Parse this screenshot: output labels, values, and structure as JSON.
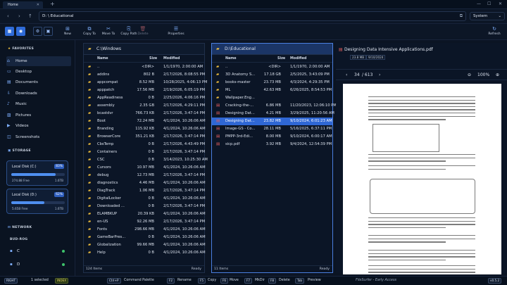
{
  "tabs": [
    {
      "label": "Home"
    }
  ],
  "window": {
    "minimize": "—",
    "maximize": "☐",
    "close": "✕"
  },
  "address": {
    "path": "D:  \\ Educational",
    "theme": "System"
  },
  "toolbar": {
    "new": "New",
    "copy_to": "Copy To",
    "move_to": "Move To",
    "copy_path": "Copy Path",
    "delete": "Delete",
    "properties": "Properties",
    "refresh": "Refresh"
  },
  "sidebar": {
    "favorites_title": "FAVORITES",
    "favorites": [
      "Home",
      "Desktop",
      "Documents",
      "Downloads",
      "Music",
      "Pictures",
      "Videos",
      "Screenshots"
    ],
    "storage_title": "STORAGE",
    "disks": [
      {
        "name": "Local Disk (C:)",
        "percent": "83%",
        "free": "274.88 Free",
        "total": "1.6TB",
        "fraction": 0.83
      },
      {
        "name": "Local Disk (D:)",
        "percent": "62%",
        "free": "5.65B Free",
        "total": "1.6TB",
        "fraction": 0.62
      }
    ],
    "network_title": "NETWORK",
    "device_name": "BUD-ROG",
    "drives": [
      "C",
      "D"
    ]
  },
  "left_pane": {
    "path": "C:\\Windows",
    "columns": {
      "name": "Name",
      "size": "Size",
      "modified": "Modified"
    },
    "rows": [
      {
        "name": "..",
        "size": "<DIR>",
        "modified": "1/1/1970, 2:00:00 AM",
        "type": "folder"
      },
      {
        "name": "addins",
        "size": "802 B",
        "modified": "2/17/2026, 8:08:55 PM",
        "type": "folder"
      },
      {
        "name": "appcompat",
        "size": "8.52 MB",
        "modified": "10/28/2025, 4:06:13 PM",
        "type": "folder"
      },
      {
        "name": "apppatch",
        "size": "17.56 MB",
        "modified": "2/19/2026, 6:05:19 PM",
        "type": "folder"
      },
      {
        "name": "AppReadiness",
        "size": "0 B",
        "modified": "2/25/2026, 4:06:16 PM",
        "type": "folder"
      },
      {
        "name": "assembly",
        "size": "2.35 GB",
        "modified": "2/17/2026, 4:29:11 PM",
        "type": "folder"
      },
      {
        "name": "bcastdvr",
        "size": "766.73 KB",
        "modified": "2/17/2026, 3:47:14 PM",
        "type": "folder"
      },
      {
        "name": "Boot",
        "size": "72.24 MB",
        "modified": "4/1/2024, 10:26:06 AM",
        "type": "folder"
      },
      {
        "name": "Branding",
        "size": "115.92 KB",
        "modified": "4/1/2024, 10:26:06 AM",
        "type": "folder"
      },
      {
        "name": "BrowserCore",
        "size": "351.21 KB",
        "modified": "2/17/2026, 3:47:14 PM",
        "type": "folder"
      },
      {
        "name": "CbsTemp",
        "size": "0 B",
        "modified": "2/17/2026, 4:43:49 PM",
        "type": "folder"
      },
      {
        "name": "Containers",
        "size": "0 B",
        "modified": "2/17/2026, 3:47:14 PM",
        "type": "folder"
      },
      {
        "name": "CSC",
        "size": "0 B",
        "modified": "3/14/2023, 10:25:30 AM",
        "type": "folder"
      },
      {
        "name": "Cursors",
        "size": "10.97 MB",
        "modified": "4/1/2024, 10:26:06 AM",
        "type": "folder"
      },
      {
        "name": "debug",
        "size": "12.73 MB",
        "modified": "2/17/2026, 3:47:14 PM",
        "type": "folder"
      },
      {
        "name": "diagnostics",
        "size": "4.46 MB",
        "modified": "4/1/2024, 10:26:06 AM",
        "type": "folder"
      },
      {
        "name": "DiagTrack",
        "size": "1.06 MB",
        "modified": "2/17/2026, 3:47:14 PM",
        "type": "folder"
      },
      {
        "name": "DigitalLocker",
        "size": "0 B",
        "modified": "4/1/2024, 10:26:06 AM",
        "type": "folder"
      },
      {
        "name": "Downloaded ...",
        "size": "0 B",
        "modified": "2/17/2026, 3:47:14 PM",
        "type": "folder"
      },
      {
        "name": "ELAMBKUP",
        "size": "20.39 KB",
        "modified": "4/1/2024, 10:26:06 AM",
        "type": "folder"
      },
      {
        "name": "en-US",
        "size": "92.26 MB",
        "modified": "2/17/2026, 3:47:14 PM",
        "type": "folder"
      },
      {
        "name": "Fonts",
        "size": "298.66 MB",
        "modified": "4/1/2024, 10:26:06 AM",
        "type": "folder"
      },
      {
        "name": "GameBarPres...",
        "size": "0 B",
        "modified": "4/1/2024, 10:26:06 AM",
        "type": "folder"
      },
      {
        "name": "Globalization",
        "size": "99.66 MB",
        "modified": "4/1/2024, 10:26:06 AM",
        "type": "folder"
      },
      {
        "name": "Help",
        "size": "0 B",
        "modified": "4/1/2024, 10:26:06 AM",
        "type": "folder"
      }
    ],
    "footer_count": "124 Items",
    "footer_status": "Ready"
  },
  "right_pane": {
    "path": "D:\\Educational",
    "columns": {
      "name": "Name",
      "size": "Size",
      "modified": "Modified"
    },
    "rows": [
      {
        "name": "..",
        "size": "<DIR>",
        "modified": "1/1/1970, 2:00:00 AM",
        "type": "folder"
      },
      {
        "name": "3D Anatomy S...",
        "size": "17.18 GB",
        "modified": "2/5/2025, 3:43:09 PM",
        "type": "folder"
      },
      {
        "name": "books-master",
        "size": "23.73 MB",
        "modified": "4/3/2024, 4:29:35 PM",
        "type": "folder"
      },
      {
        "name": "ML",
        "size": "42.63 MB",
        "modified": "6/26/2025, 8:54:53 PM",
        "type": "folder"
      },
      {
        "name": "Wallpaper.Eng...",
        "size": "",
        "modified": "",
        "type": "folder"
      },
      {
        "name": "Cracking-the-...",
        "size": "6.86 MB",
        "modified": "11/20/2023, 12:06:10 PM",
        "type": "pdf"
      },
      {
        "name": "Designing Dat...",
        "size": "4.21 MB",
        "modified": "3/29/2025, 11:20:56 AM",
        "type": "pdf"
      },
      {
        "name": "Designing Dat...",
        "size": "23.82 MB",
        "modified": "9/10/2024, 6:01:23 AM",
        "type": "pdf",
        "selected": true
      },
      {
        "name": "Image-GS - Co...",
        "size": "28.11 MB",
        "modified": "5/16/2025, 6:37:11 PM",
        "type": "pdf"
      },
      {
        "name": "PMPP-3rd-Edi...",
        "size": "8.00 MB",
        "modified": "9/10/2024, 6:00:17 AM",
        "type": "pdf"
      },
      {
        "name": "sicp.pdf",
        "size": "3.92 MB",
        "modified": "9/4/2024, 12:54:39 PM",
        "type": "pdf"
      }
    ],
    "footer_count": "11 Items",
    "footer_status": "Ready"
  },
  "preview": {
    "title": "Designing Data Intensive Applications.pdf",
    "size_badge": "23.8 MB",
    "date_badge": "9/10/2024",
    "page": "34",
    "page_total": "/ 613",
    "zoom": "100%"
  },
  "statusbar": {
    "mode": "RIGHT",
    "selection": "1 selected",
    "index_badge": "INDEX",
    "keys": [
      {
        "key": "Ctrl+P",
        "label": "Command Palette"
      },
      {
        "key": "F2",
        "label": "Rename"
      },
      {
        "key": "F5",
        "label": "Copy"
      },
      {
        "key": "F6",
        "label": "Move"
      },
      {
        "key": "F7",
        "label": "MkDir"
      },
      {
        "key": "F8",
        "label": "Delete"
      },
      {
        "key": "Tab",
        "label": "Preview"
      }
    ],
    "app": "FileSurfer - Early Access",
    "version": "v0.5.2"
  }
}
